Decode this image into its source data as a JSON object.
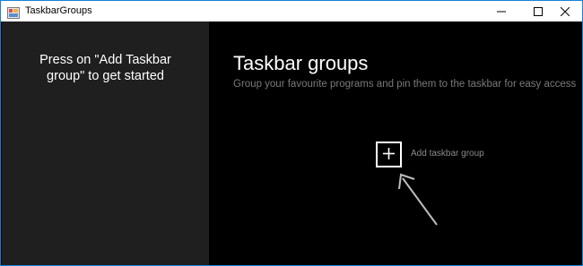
{
  "window": {
    "title": "TaskbarGroups",
    "accent_color": "#1883d7"
  },
  "icons": {
    "app": "taskbar-groups-app-icon",
    "minimize": "minimize-icon",
    "maximize": "maximize-icon",
    "close": "close-icon",
    "add": "plus-icon",
    "hint": "arrow-pointer-icon"
  },
  "sidebar": {
    "line1": "Press on \"Add Taskbar",
    "line2": "group\" to get started"
  },
  "main": {
    "title": "Taskbar groups",
    "subtitle": "Group your favourite programs and pin them to the taskbar for easy access",
    "add_label": "Add taskbar group"
  },
  "colors": {
    "sidebar_bg": "#1f1f1f",
    "main_bg": "#000000",
    "subtitle": "#7a7a7a"
  }
}
